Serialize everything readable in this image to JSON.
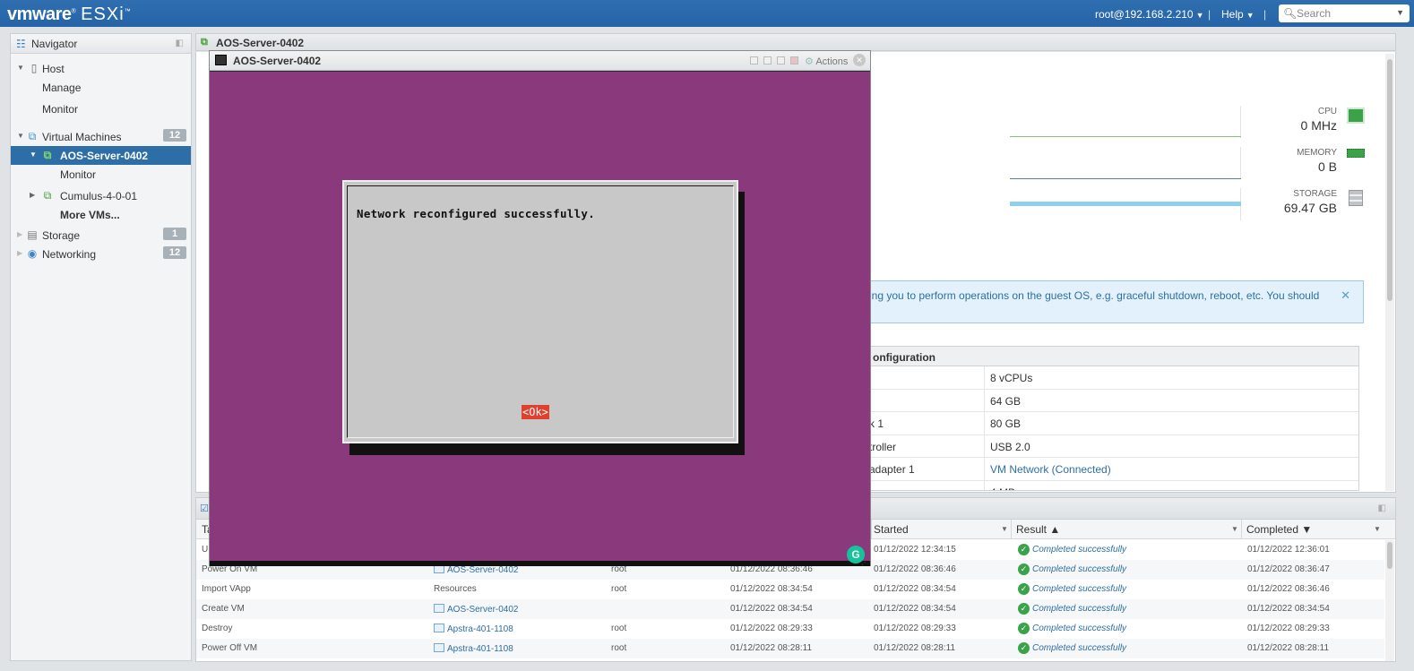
{
  "app": {
    "brand": "vmware",
    "product": "ESXi",
    "user": "root@192.168.2.210",
    "separator": "|",
    "help": "Help",
    "search_placeholder": "Search"
  },
  "navigator": {
    "title": "Navigator",
    "host": {
      "label": "Host",
      "children": [
        "Manage",
        "Monitor"
      ]
    },
    "vms": {
      "label": "Virtual Machines",
      "count": "12",
      "selected": "AOS-Server-0402",
      "selected_child": "Monitor",
      "other": "Cumulus-4-0-01",
      "more": "More VMs..."
    },
    "storage": {
      "label": "Storage",
      "count": "1"
    },
    "networking": {
      "label": "Networking",
      "count": "12"
    }
  },
  "main": {
    "tab_title": "AOS-Server-0402",
    "resources": [
      {
        "label": "CPU",
        "value": "0 MHz",
        "color": "#3aa34a"
      },
      {
        "label": "MEMORY",
        "value": "0 B",
        "color": "#3aa34a"
      },
      {
        "label": "STORAGE",
        "value": "69.47 GB",
        "color": "#9aa0a6"
      }
    ],
    "banner_text": "ing you to perform operations on the guest OS, e.g. graceful shutdown, reboot, etc. You should",
    "config": {
      "header": "onfiguration",
      "rows": [
        {
          "key": "",
          "value": "8 vCPUs"
        },
        {
          "key": "",
          "value": "64 GB"
        },
        {
          "key": "k 1",
          "value": "80 GB"
        },
        {
          "key": "troller",
          "value": "USB 2.0"
        },
        {
          "key": "adapter 1",
          "value": "VM Network (Connected)"
        },
        {
          "key": "",
          "value": "4 MB"
        }
      ]
    }
  },
  "console": {
    "title": "AOS-Server-0402",
    "actions": "Actions",
    "message": "Network reconfigured successfully.",
    "ok_button": "<Ok>"
  },
  "tasks": {
    "columns": {
      "task": "Ta",
      "started": "Started",
      "result": "Result ▲",
      "completed": "Completed ▼"
    },
    "rows": [
      {
        "task": "U",
        "target": "",
        "initiator": "",
        "queued": "",
        "started": "01/12/2022 12:34:15",
        "result": "Completed successfully",
        "completed": "01/12/2022 12:36:01"
      },
      {
        "task": "Power On VM",
        "target": "AOS-Server-0402",
        "initiator": "root",
        "queued": "01/12/2022 08:36:46",
        "started": "01/12/2022 08:36:46",
        "result": "Completed successfully",
        "completed": "01/12/2022 08:36:47"
      },
      {
        "task": "Import VApp",
        "target": "Resources",
        "initiator": "root",
        "queued": "01/12/2022 08:34:54",
        "started": "01/12/2022 08:34:54",
        "result": "Completed successfully",
        "completed": "01/12/2022 08:36:46"
      },
      {
        "task": "Create VM",
        "target": "AOS-Server-0402",
        "initiator": "",
        "queued": "01/12/2022 08:34:54",
        "started": "01/12/2022 08:34:54",
        "result": "Completed successfully",
        "completed": "01/12/2022 08:34:54"
      },
      {
        "task": "Destroy",
        "target": "Apstra-401-1108",
        "initiator": "root",
        "queued": "01/12/2022 08:29:33",
        "started": "01/12/2022 08:29:33",
        "result": "Completed successfully",
        "completed": "01/12/2022 08:29:33"
      },
      {
        "task": "Power Off VM",
        "target": "Apstra-401-1108",
        "initiator": "root",
        "queued": "01/12/2022 08:28:11",
        "started": "01/12/2022 08:28:11",
        "result": "Completed successfully",
        "completed": "01/12/2022 08:28:11"
      }
    ]
  }
}
